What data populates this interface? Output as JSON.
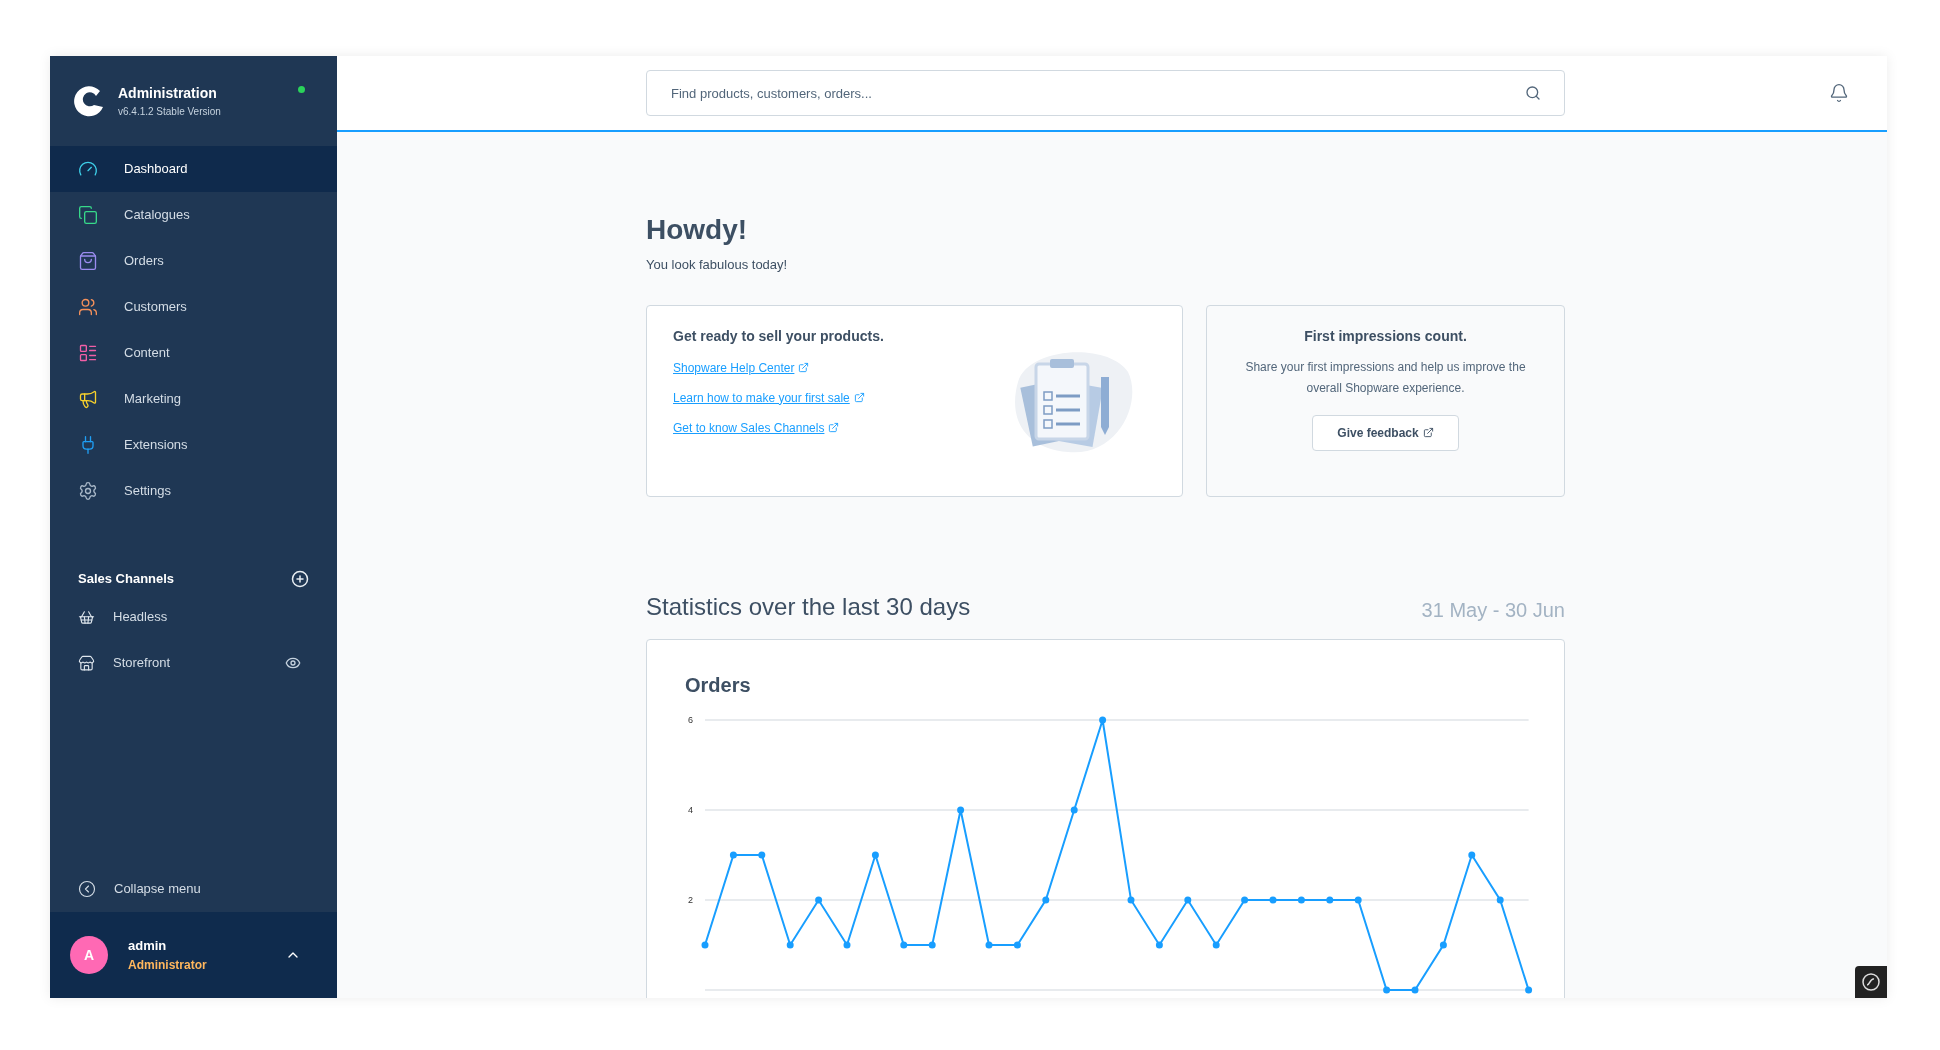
{
  "brand": {
    "title": "Administration",
    "version": "v6.4.1.2 Stable Version"
  },
  "nav": [
    {
      "label": "Dashboard",
      "selected": true,
      "color": "#3ecfe8"
    },
    {
      "label": "Catalogues",
      "selected": false,
      "color": "#37d98a"
    },
    {
      "label": "Orders",
      "selected": false,
      "color": "#9a8cf0"
    },
    {
      "label": "Customers",
      "selected": false,
      "color": "#f5915b"
    },
    {
      "label": "Content",
      "selected": false,
      "color": "#f25fa6"
    },
    {
      "label": "Marketing",
      "selected": false,
      "color": "#f7d12c"
    },
    {
      "label": "Extensions",
      "selected": false,
      "color": "#1f9ff5"
    },
    {
      "label": "Settings",
      "selected": false,
      "color": "#a9b8c8"
    }
  ],
  "sales_channels": {
    "title": "Sales Channels",
    "items": [
      {
        "label": "Headless",
        "kind": "plain"
      },
      {
        "label": "Storefront",
        "kind": "preview"
      }
    ]
  },
  "collapse": "Collapse menu",
  "user": {
    "initial": "A",
    "name": "admin",
    "role": "Administrator"
  },
  "search": {
    "placeholder": "Find products, customers, orders..."
  },
  "greeting": {
    "title": "Howdy!",
    "subtitle": "You look fabulous today!"
  },
  "ready_card": {
    "title": "Get ready to sell your products.",
    "links": [
      "Shopware Help Center",
      "Learn how to make your first sale",
      "Get to know Sales Channels"
    ]
  },
  "feedback_card": {
    "title": "First impressions count.",
    "text": "Share your first impressions and help us improve the overall Shopware experience.",
    "button": "Give feedback"
  },
  "statistics": {
    "title": "Statistics over the last 30 days",
    "range": "31 May - 30 Jun",
    "chart_data": {
      "type": "line",
      "title": "Orders",
      "ylim": [
        0,
        6
      ],
      "yticks": [
        2,
        4,
        6
      ],
      "series": [
        {
          "color": "#189eff",
          "marker": "circle",
          "values": [
            1,
            3,
            3,
            1,
            2,
            1,
            3,
            1,
            1,
            4,
            1,
            1,
            2,
            4,
            6,
            2,
            1,
            2,
            1,
            2,
            2,
            2,
            2,
            2,
            0,
            0,
            1,
            3,
            2,
            0
          ]
        }
      ]
    }
  }
}
